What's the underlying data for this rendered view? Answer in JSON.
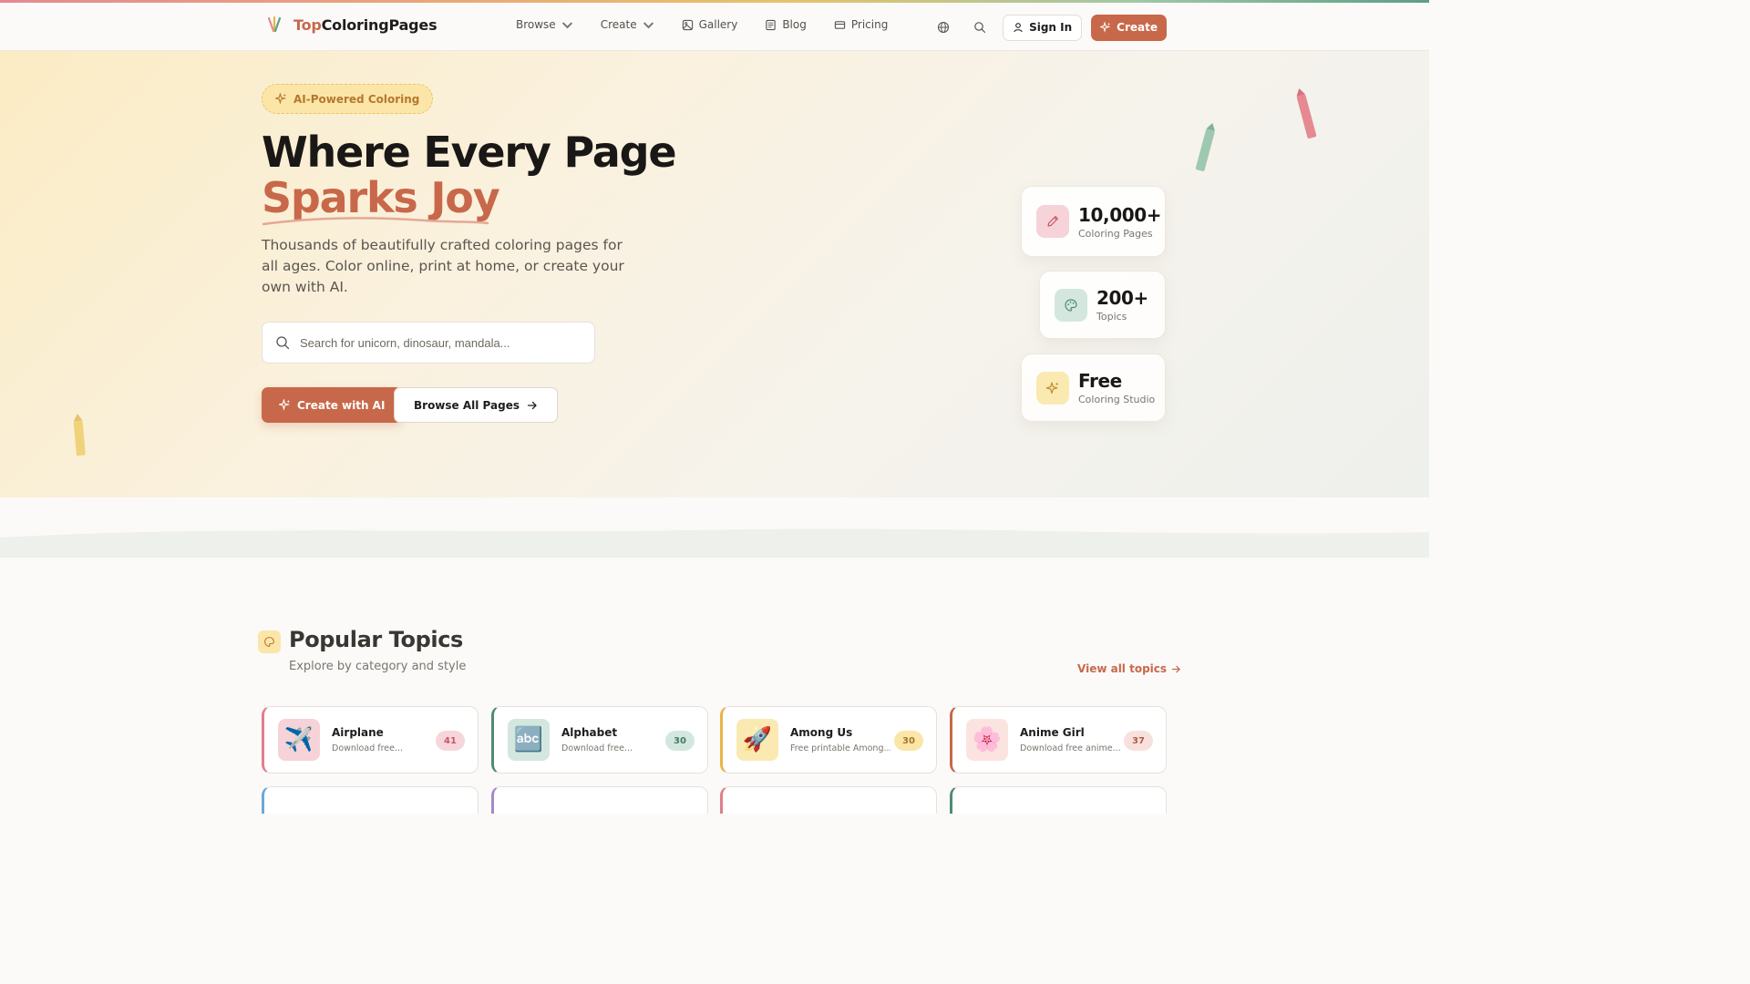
{
  "brand": {
    "name_part1": "Top",
    "name_part2": "ColoringPages"
  },
  "nav": {
    "items": [
      {
        "label": "Browse",
        "dropdown": true
      },
      {
        "label": "Create",
        "dropdown": true
      },
      {
        "label": "Gallery",
        "icon": "image-icon"
      },
      {
        "label": "Blog",
        "icon": "newspaper-icon"
      },
      {
        "label": "Pricing",
        "icon": "credit-card-icon"
      }
    ],
    "signin_label": "Sign In",
    "create_label": "Create"
  },
  "hero": {
    "badge": "AI-Powered Coloring",
    "title_line1": "Where Every Page",
    "title_line2": "Sparks Joy",
    "lead": "Thousands of beautifully crafted coloring pages for all ages. Color online, print at home, or create your own with AI.",
    "search_placeholder": "Search for unicorn, dinosaur, mandala...",
    "cta_primary": "Create with AI",
    "cta_secondary": "Browse All Pages"
  },
  "stats": [
    {
      "value": "10,000+",
      "label": "Coloring Pages",
      "icon": "pencil-icon",
      "color": "#f6d3d8"
    },
    {
      "value": "200+",
      "label": "Topics",
      "icon": "palette-icon",
      "color": "#d4e7df"
    },
    {
      "value": "Free",
      "label": "Coloring Studio",
      "icon": "sparkles-icon",
      "color": "#fbe9b2"
    }
  ],
  "popular": {
    "title": "Popular Topics",
    "subtitle": "Explore by category and style",
    "view_all": "View all topics",
    "topics": [
      {
        "name": "Airplane",
        "desc": "Download free...",
        "count": "41",
        "emoji": "✈️",
        "accent": "#e07f8a",
        "thumb_bg": "#f6d3d8",
        "count_bg": "#f7d6db",
        "count_color": "#c9566a"
      },
      {
        "name": "Alphabet",
        "desc": "Download free...",
        "count": "30",
        "emoji": "🔤",
        "accent": "#4f8c74",
        "thumb_bg": "#d4e7df",
        "count_bg": "#d4e7df",
        "count_color": "#3f7a63"
      },
      {
        "name": "Among Us",
        "desc": "Free printable Among...",
        "count": "30",
        "emoji": "🚀",
        "accent": "#e8b54a",
        "thumb_bg": "#fbe9b2",
        "count_bg": "#fbe6a8",
        "count_color": "#a3762a"
      },
      {
        "name": "Anime Girl",
        "desc": "Download free anime...",
        "count": "37",
        "emoji": "🌸",
        "accent": "#c8684a",
        "thumb_bg": "#fbe4e0",
        "count_bg": "#f8e1dc",
        "count_color": "#b35a47"
      }
    ],
    "next_row_accents": [
      "#6aa8d8",
      "#a988c9",
      "#e07f8a",
      "#4f8c74"
    ]
  }
}
